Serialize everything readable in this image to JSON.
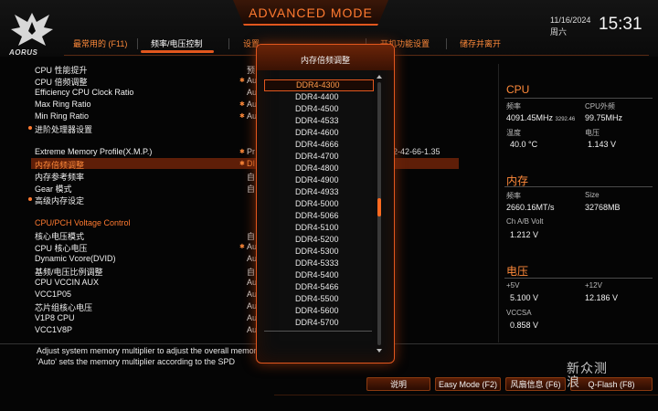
{
  "header": {
    "logo_text": "AORUS",
    "mode_title": "ADVANCED MODE",
    "date": "11/16/2024",
    "weekday": "周六",
    "time": "15:31"
  },
  "tabs": [
    {
      "label": "最常用的 (F11)",
      "active": false
    },
    {
      "label": "频率/电压控制",
      "active": true
    },
    {
      "label": "设置",
      "active": false
    },
    {
      "label": "开机功能设置",
      "active": false
    },
    {
      "label": "储存并离开",
      "active": false
    }
  ],
  "settings": {
    "cpu_ratio_boost": {
      "label": "CPU 性能提升",
      "value": "预"
    },
    "cpu_ratio": {
      "label": "CPU 倍频调整",
      "value": "Au"
    },
    "efficiency_ratio": {
      "label": "Efficiency CPU Clock Ratio",
      "value": "Au"
    },
    "max_ring": {
      "label": "Max Ring Ratio",
      "value": "Au"
    },
    "min_ring": {
      "label": "Min Ring Ratio",
      "value": "Au"
    },
    "advanced_cpu": {
      "label": "进阶处理器设置"
    },
    "xmp": {
      "label": "Extreme Memory Profile(X.M.P.)",
      "value": "Pr",
      "tail": "2-42-66-1.35"
    },
    "mem_multiplier": {
      "label": "内存倍频调整",
      "value": "DI"
    },
    "mem_ref_freq": {
      "label": "内存参考频率",
      "value": "自"
    },
    "gear_mode": {
      "label": "Gear 模式",
      "value": "自"
    },
    "advanced_mem": {
      "label": "高级内存设定"
    },
    "voltage_section": {
      "label": "CPU/PCH Voltage Control"
    },
    "core_vmode": {
      "label": "核心电压模式",
      "value": "自"
    },
    "cpu_vcore": {
      "label": "CPU 核心电压",
      "value": "Au"
    },
    "dvid": {
      "label": "Dynamic Vcore(DVID)",
      "value": "Au"
    },
    "bclk_ratio": {
      "label": "基频/电压比例调整",
      "value": "自"
    },
    "vccin_aux": {
      "label": "CPU VCCIN AUX",
      "value": "Au"
    },
    "vcc1p05": {
      "label": "VCC1P05",
      "value": "Au"
    },
    "pch_core": {
      "label": "芯片组核心电压",
      "value": "Au"
    },
    "v1p8": {
      "label": "V1P8 CPU",
      "value": "Au"
    },
    "vcc1v8p": {
      "label": "VCC1V8P",
      "value": "Au"
    }
  },
  "popup": {
    "title": "内存倍频调整",
    "options": [
      "DDR4-4300",
      "DDR4-4400",
      "DDR4-4500",
      "DDR4-4533",
      "DDR4-4600",
      "DDR4-4666",
      "DDR4-4700",
      "DDR4-4800",
      "DDR4-4900",
      "DDR4-4933",
      "DDR4-5000",
      "DDR4-5066",
      "DDR4-5100",
      "DDR4-5200",
      "DDR4-5300",
      "DDR4-5333",
      "DDR4-5400",
      "DDR4-5466",
      "DDR4-5500",
      "DDR4-5600",
      "DDR4-5700"
    ],
    "selected": "DDR4-4300"
  },
  "info": {
    "cpu": {
      "heading": "CPU",
      "freq_label": "频率",
      "freq_value": "4091.45MHz",
      "freq_sub": "3292.46",
      "bclk_label": "CPU外频",
      "bclk_value": "99.75MHz",
      "temp_label": "温度",
      "temp_value": "40.0 °C",
      "volt_label": "电压",
      "volt_value": "1.143 V"
    },
    "memory": {
      "heading": "内存",
      "freq_label": "频率",
      "freq_value": "2660.16MT/s",
      "size_label": "Size",
      "size_value": "32768MB",
      "volt_label": "Ch A/B Volt",
      "volt_value": "1.212 V"
    },
    "voltage": {
      "heading": "电压",
      "p5_label": "+5V",
      "p5_value": "5.100 V",
      "p12_label": "+12V",
      "p12_value": "12.186 V",
      "vccsa_label": "VCCSA",
      "vccsa_value": "0.858 V"
    }
  },
  "help": {
    "line1": "Adjust system memory multiplier to adjust the overall memory speed.",
    "line2": "'Auto' sets the memory multiplier according to the SPD"
  },
  "footer": {
    "explain": "说明",
    "easy_mode": "Easy Mode (F2)",
    "fan_info": "风扇信息 (F6)",
    "qflash": "Q-Flash (F8)"
  },
  "watermark": {
    "line1": "新",
    "line2": "浪",
    "brand": "众测"
  },
  "colors": {
    "accent": "#e2571e",
    "accent_text": "#ff8a3a",
    "background": "#050505"
  }
}
